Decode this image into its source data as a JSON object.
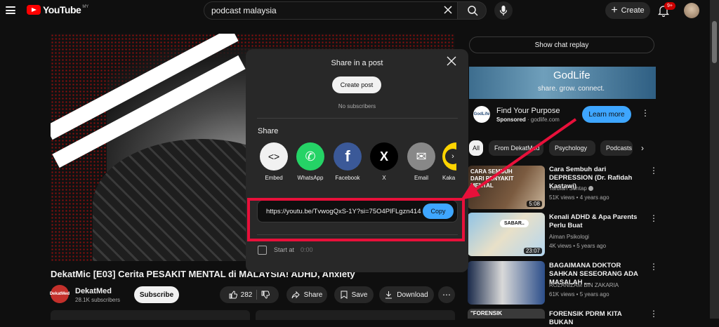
{
  "header": {
    "logo_text": "YouTube",
    "region": "MY",
    "search_value": "podcast malaysia",
    "create_label": "Create",
    "notification_count": "9+"
  },
  "video": {
    "title": "DekatMic [E03] Cerita PESAKIT MENTAL di MALAYSIA! ADHD, Anxiety",
    "channel": "DekatMed",
    "channel_avatar_text": "DekatMed",
    "subscribers": "28.1K subscribers",
    "subscribe_label": "Subscribe",
    "likes": "282",
    "share_label": "Share",
    "save_label": "Save",
    "download_label": "Download"
  },
  "sidebar": {
    "chat_replay": "Show chat replay",
    "ad": {
      "banner_title": "GodLife",
      "banner_tagline": "share. grow. connect.",
      "logo_text": "GodLife",
      "title": "Find Your Purpose",
      "sponsored": "Sponsored",
      "domain": "godlife.com",
      "cta": "Learn more"
    },
    "chips": [
      "All",
      "From DekatMed",
      "Psychology",
      "Podcasts"
    ],
    "related": [
      {
        "title": "Cara Sembuh dari DEPRESSION (Dr. Rafidah Kastawi)",
        "channel": "Tarbiah Sentap",
        "stats": "51K views • 4 years ago",
        "duration": "5:08",
        "thumb_text": "CARA SEMBUH DARI PENYAKIT MENTAL"
      },
      {
        "title": "Kenali ADHD & Apa Parents Perlu Buat",
        "channel": "Aiman Psikologi",
        "stats": "4K views • 5 years ago",
        "duration": "23:07",
        "thumb_text": "SABAR.."
      },
      {
        "title": "BAGAIMANA DOKTOR SAHKAN SESEORANG ADA MASALAH ...",
        "channel": "ROZANIZAM BIN ZAKARIA",
        "stats": "61K views • 5 years ago",
        "duration": "",
        "thumb_text": ""
      },
      {
        "title": "FORENSIK PDRM KITA BUKAN",
        "channel": "",
        "stats": "",
        "duration": "",
        "thumb_text": "\"FORENSIK"
      }
    ]
  },
  "modal": {
    "title": "Share in a post",
    "create_post": "Create post",
    "no_subscribers": "No subscribers",
    "share_heading": "Share",
    "targets": [
      {
        "label": "Embed",
        "glyph": "<>",
        "color": "#f1f1f1"
      },
      {
        "label": "WhatsApp",
        "glyph": "✆",
        "color": "#25d366"
      },
      {
        "label": "Facebook",
        "glyph": "f",
        "color": "#3b5998"
      },
      {
        "label": "X",
        "glyph": "X",
        "color": "#000000"
      },
      {
        "label": "Email",
        "glyph": "✉",
        "color": "#888888"
      },
      {
        "label": "Kaka",
        "glyph": "",
        "color": "#ffd400"
      }
    ],
    "link": "https://youtu.be/TvwogQxS-1Y?si=75O4PlFLgzn414",
    "copy_label": "Copy",
    "start_at_label": "Start at",
    "start_time": "0:00"
  }
}
